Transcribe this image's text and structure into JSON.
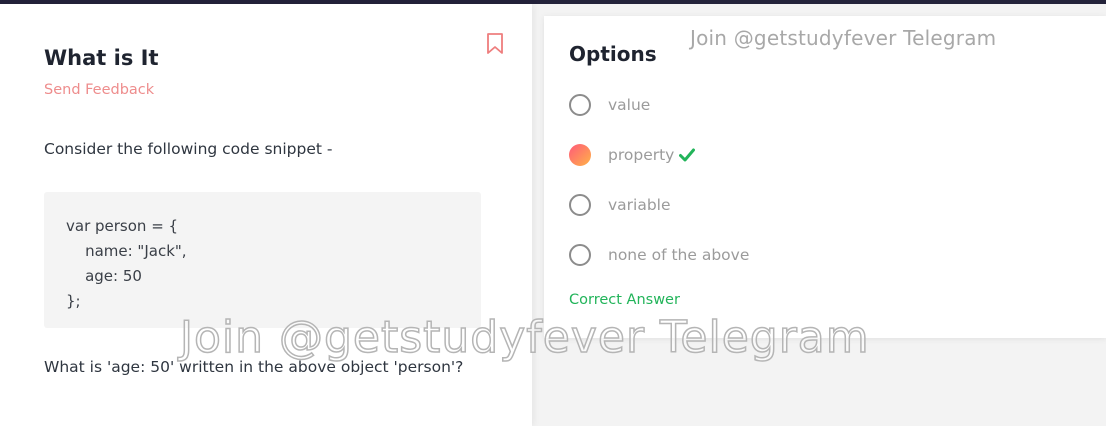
{
  "question": {
    "title": "What is It",
    "feedback_link": "Send Feedback",
    "prompt": "Consider the following code snippet -",
    "code": [
      "var person = {",
      "    name: \"Jack\",",
      "    age: 50",
      "};"
    ],
    "text": "What is 'age: 50' written in the above object 'person'?"
  },
  "options": {
    "heading": "Options",
    "items": [
      {
        "label": "value",
        "selected": false
      },
      {
        "label": "property",
        "selected": true,
        "correct": true
      },
      {
        "label": "variable",
        "selected": false
      },
      {
        "label": "none of the above",
        "selected": false
      }
    ],
    "result": "Correct Answer"
  },
  "watermark": {
    "top": "Join @getstudyfever Telegram",
    "overlay": "Join @getstudyfever Telegram"
  },
  "icons": {
    "bookmark": "bookmark-icon",
    "check": "check-icon"
  },
  "colors": {
    "accent_pink": "#ee8d8d",
    "success": "#22b45a",
    "selected_gradient": [
      "#ff5a7a",
      "#ffb347"
    ],
    "header_strip": "#23223a"
  }
}
